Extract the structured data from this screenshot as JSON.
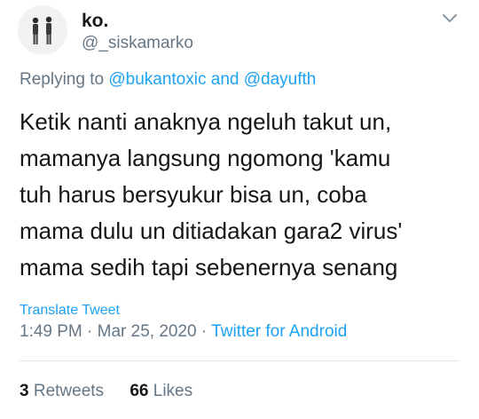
{
  "author": {
    "display_name": "ko.",
    "username": "@_siskamarko",
    "avatar_icon": "avatar-photo-two-people"
  },
  "reply": {
    "prefix": "Replying to",
    "user1": "@bukantoxic",
    "conjunction": "and",
    "user2": "@dayufth"
  },
  "tweet": {
    "text": "Ketik nanti anaknya ngeluh takut un,\nmamanya langsung ngomong 'kamu\ntuh harus bersyukur bisa un, coba\nmama dulu un ditiadakan gara2 virus'\nmama sedih tapi sebenernya senang"
  },
  "translate_label": "Translate Tweet",
  "meta": {
    "time": "1:49 PM",
    "separator": "·",
    "date": "Mar 25, 2020",
    "source": "Twitter for Android"
  },
  "stats": {
    "retweets_count": "3",
    "retweets_label": "Retweets",
    "likes_count": "66",
    "likes_label": "Likes"
  },
  "colors": {
    "link": "#1da1f2",
    "secondary_text": "#657786",
    "primary_text": "#14171a",
    "divider": "#e1e8ed"
  }
}
